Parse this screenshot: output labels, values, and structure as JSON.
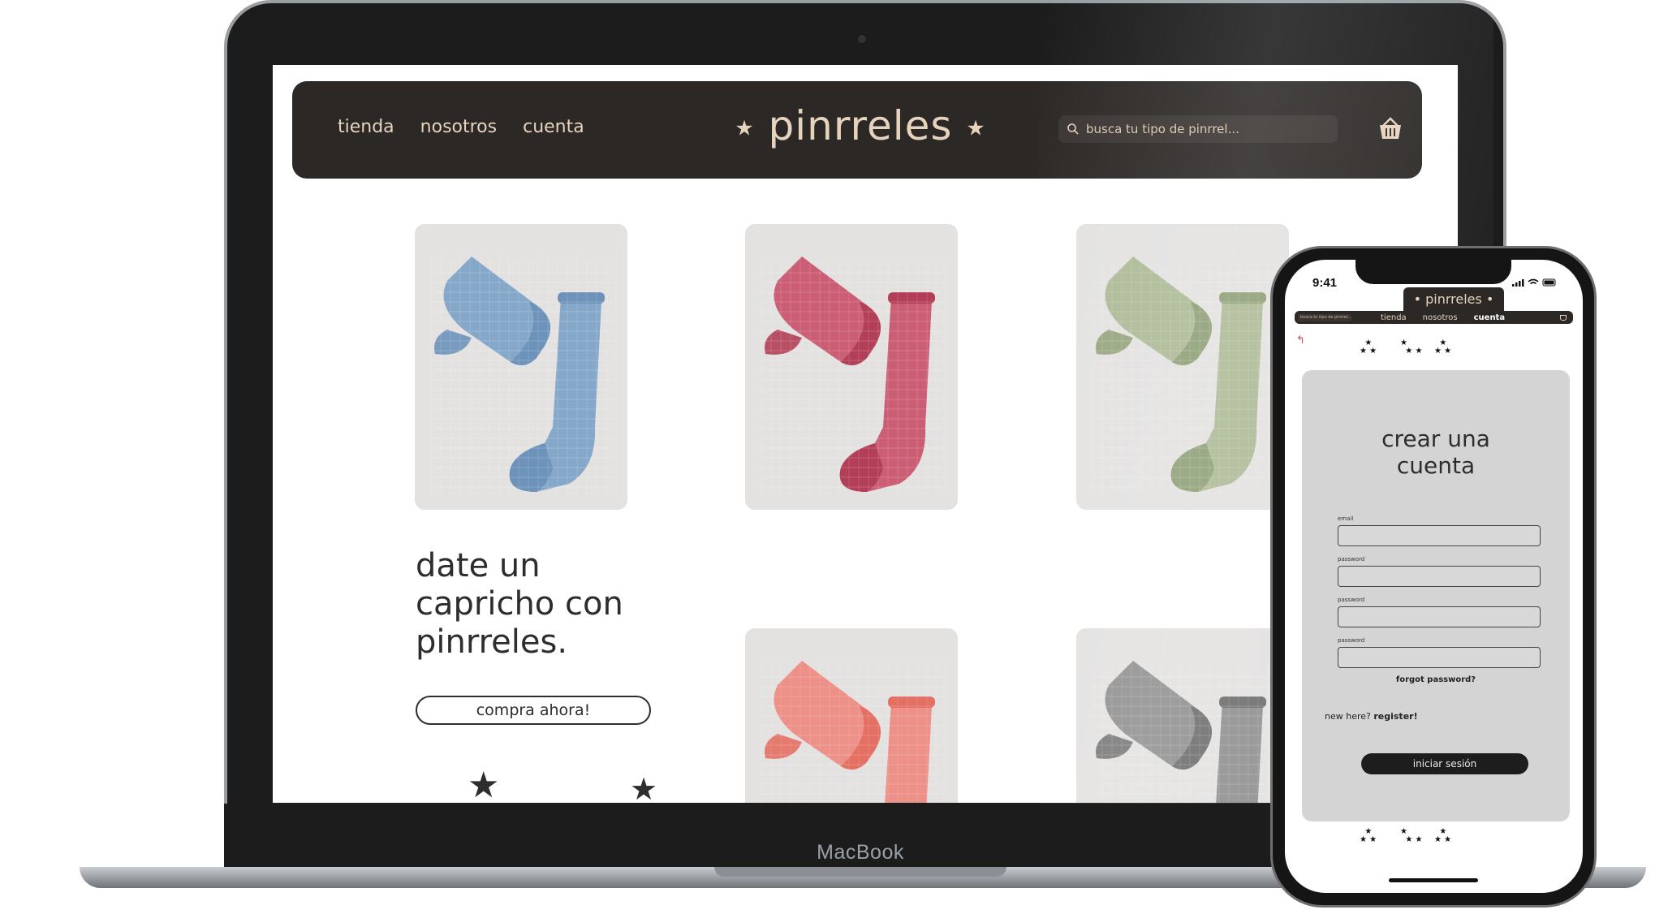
{
  "device_labels": {
    "laptop_brand": "MacBook"
  },
  "desktop": {
    "nav": {
      "items": [
        "tienda",
        "nosotros",
        "cuenta"
      ]
    },
    "logo": {
      "text": "pinrreles",
      "star": "★"
    },
    "search": {
      "placeholder": "busca tu tipo de pinrrel..."
    },
    "cart_icon": "basket-icon",
    "products": [
      {
        "name": "blue-socks",
        "color": "#7da3c8",
        "accent": "#6d93bb"
      },
      {
        "name": "red-socks",
        "color": "#c9536a",
        "accent": "#b23f57"
      },
      {
        "name": "sage-socks",
        "color": "#a8b68f",
        "accent": "#8fa077"
      },
      {
        "name": "coral-socks",
        "color": "#ee8a80",
        "accent": "#e46f63"
      },
      {
        "name": "grey-socks",
        "color": "#8a8a8a",
        "accent": "#6f6f6f"
      }
    ],
    "hero": {
      "line1": "date un",
      "line2": "capricho con",
      "line3": "pinrreles.",
      "cta": "compra ahora!"
    },
    "colors": {
      "header_bg": "#2b2826",
      "header_text": "#e6d3bd",
      "card_bg": "#e3e2e1"
    }
  },
  "mobile": {
    "status": {
      "time": "9:41"
    },
    "logo": "pinrreles",
    "search_placeholder": "busca tu tipo de pinrrel...",
    "nav": {
      "tienda": "tienda",
      "nosotros": "nosotros",
      "cuenta": "cuenta"
    },
    "form": {
      "title_line1": "crear una",
      "title_line2": "cuenta",
      "fields": [
        {
          "label": "email"
        },
        {
          "label": "password"
        },
        {
          "label": "password"
        },
        {
          "label": "password"
        }
      ],
      "forgot": "forgot password?",
      "new_here": "new here?",
      "register": "register!",
      "submit": "iniciar sesión"
    }
  }
}
